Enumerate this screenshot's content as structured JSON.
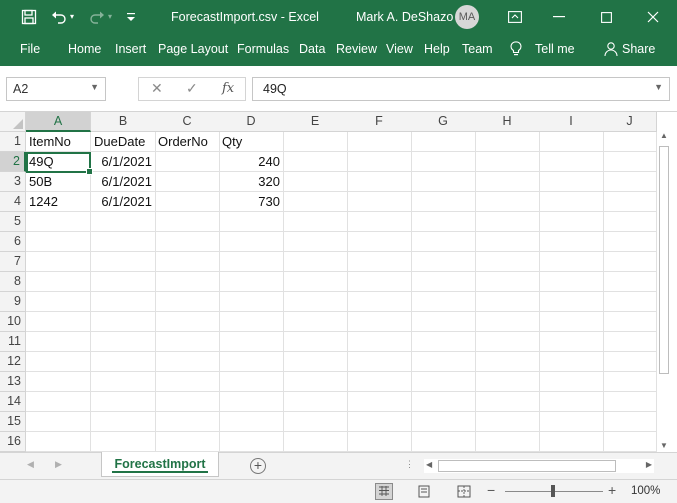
{
  "window": {
    "title": "ForecastImport.csv  -  Excel",
    "user_name": "Mark A. DeShazo",
    "user_initials": "MA"
  },
  "menu": {
    "items": [
      "File",
      "Home",
      "Insert",
      "Page Layout",
      "Formulas",
      "Data",
      "Review",
      "View",
      "Help",
      "Team",
      "Tell me",
      "Share"
    ]
  },
  "formula_bar": {
    "name_box": "A2",
    "fx_label": "fx",
    "value": "49Q"
  },
  "grid": {
    "columns": [
      "A",
      "B",
      "C",
      "D",
      "E",
      "F",
      "G",
      "H",
      "I",
      "J"
    ],
    "row_numbers": [
      "1",
      "2",
      "3",
      "4",
      "5",
      "6",
      "7",
      "8",
      "9",
      "10",
      "11",
      "12",
      "13",
      "14",
      "15",
      "16"
    ],
    "rows": [
      [
        "ItemNo",
        "DueDate",
        "OrderNo",
        "Qty"
      ],
      [
        "49Q",
        "6/1/2021",
        "",
        "240"
      ],
      [
        "50B",
        "6/1/2021",
        "",
        "320"
      ],
      [
        "1242",
        "6/1/2021",
        "",
        "730"
      ]
    ],
    "active_cell": "A2"
  },
  "sheets": {
    "tabs": [
      "ForecastImport"
    ],
    "add_symbol": "+"
  },
  "status": {
    "zoom": "100%"
  },
  "colors": {
    "accent": "#217346",
    "header_bg": "#f3f3f3",
    "gridline": "#e1e1e1"
  }
}
